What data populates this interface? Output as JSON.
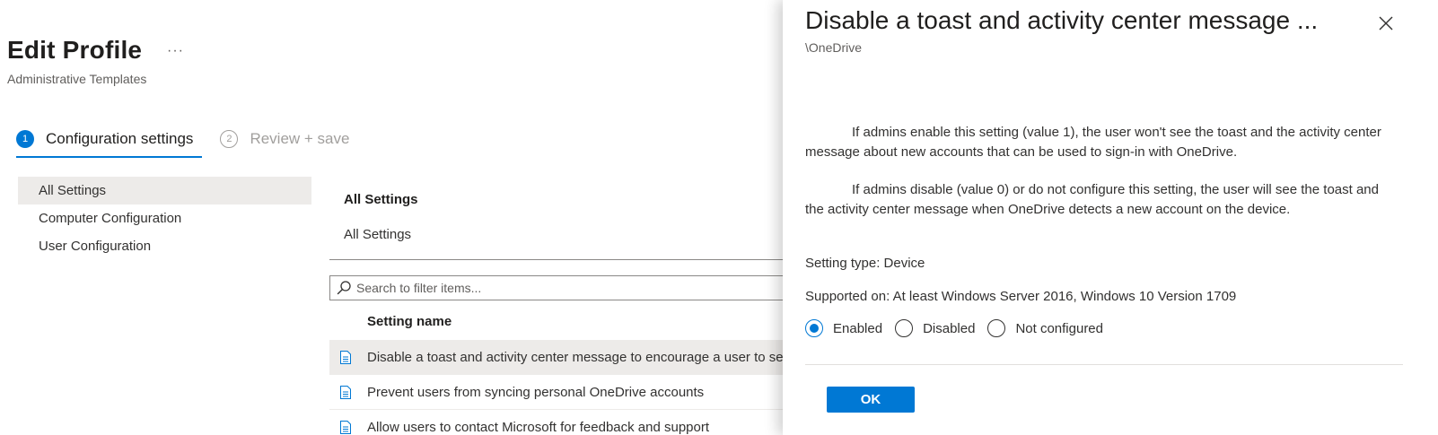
{
  "page": {
    "title": "Edit Profile",
    "more_label": "···",
    "subtitle": "Administrative Templates"
  },
  "wizard": {
    "steps": [
      {
        "number": "1",
        "label": "Configuration settings",
        "state": "active"
      },
      {
        "number": "2",
        "label": "Review + save",
        "state": "inactive"
      }
    ]
  },
  "nav": {
    "items": [
      {
        "label": "All Settings",
        "selected": true
      },
      {
        "label": "Computer Configuration",
        "selected": false
      },
      {
        "label": "User Configuration",
        "selected": false
      }
    ]
  },
  "content": {
    "heading": "All Settings",
    "breadcrumb": "All Settings",
    "search_placeholder": "Search to filter items...",
    "column_header": "Setting name",
    "rows": [
      {
        "label": "Disable a toast and activity center message to encourage a user to set up OneDrive"
      },
      {
        "label": "Prevent users from syncing personal OneDrive accounts"
      },
      {
        "label": "Allow users to contact Microsoft for feedback and support"
      }
    ]
  },
  "panel": {
    "title": "Disable a toast and activity center message ...",
    "subtitle": "\\OneDrive",
    "paragraph1": "If admins enable this setting (value 1), the user won't see the toast and the activity center message about new accounts that can be used to sign-in with OneDrive.",
    "paragraph2": "If admins disable (value 0) or do not configure this setting, the user will see the toast and the activity center message when OneDrive detects a new account on the device.",
    "setting_type": "Setting type: Device",
    "supported_on": "Supported on: At least Windows Server 2016, Windows 10 Version 1709",
    "options": [
      {
        "label": "Enabled",
        "checked": true
      },
      {
        "label": "Disabled",
        "checked": false
      },
      {
        "label": "Not configured",
        "checked": false
      }
    ],
    "ok_label": "OK"
  },
  "colors": {
    "accent": "#0078d4",
    "selected_bg": "#edebe9"
  },
  "icons": {
    "more": "more-icon",
    "search": "search-icon",
    "row": "document-icon",
    "close": "close-icon"
  }
}
